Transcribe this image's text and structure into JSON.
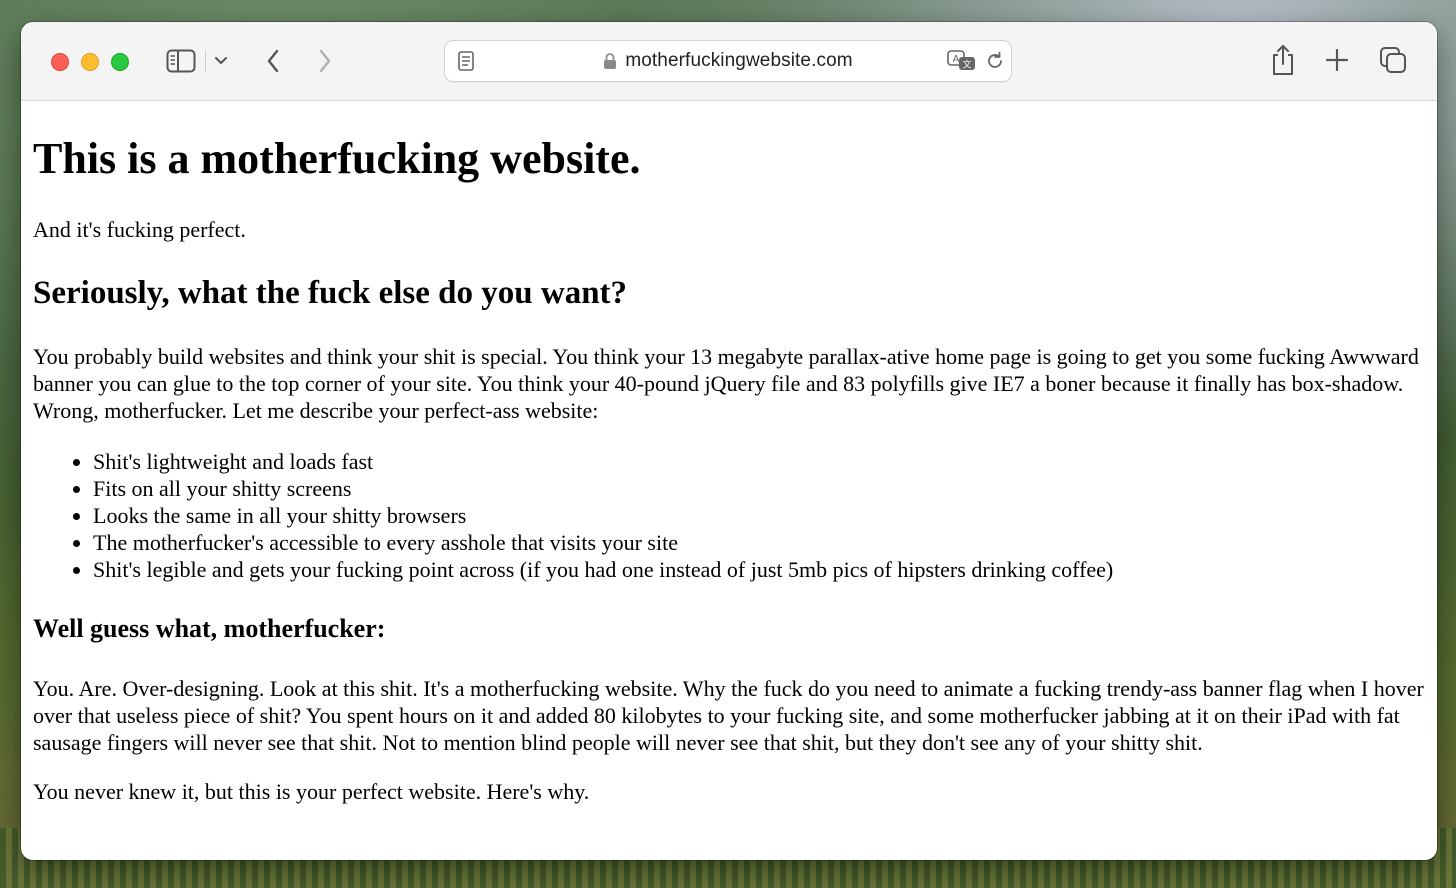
{
  "browser": {
    "url": "motherfuckingwebsite.com",
    "icons": {
      "sidebar": "sidebar-icon",
      "sidebar_menu": "chevron-down-icon",
      "back": "chevron-left-icon",
      "forward": "chevron-right-icon",
      "reader": "reader-icon",
      "lock": "lock-icon",
      "translate": "translate-icon",
      "reload": "reload-icon",
      "share": "share-icon",
      "new_tab": "plus-icon",
      "tab_overview": "tabs-icon"
    },
    "traffic_lights": {
      "close": "#fe5f57",
      "minimize": "#febc2e",
      "zoom": "#28c840"
    }
  },
  "page": {
    "title": "This is a motherfucking website.",
    "intro": "And it's fucking perfect.",
    "subtitle": "Seriously, what the fuck else do you want?",
    "paragraph1": "You probably build websites and think your shit is special. You think your 13 megabyte parallax-ative home page is going to get you some fucking Awwward banner you can glue to the top corner of your site. You think your 40-pound jQuery file and 83 polyfills give IE7 a boner because it finally has box-shadow. Wrong, motherfucker. Let me describe your perfect-ass website:",
    "list": [
      "Shit's lightweight and loads fast",
      "Fits on all your shitty screens",
      "Looks the same in all your shitty browsers",
      "The motherfucker's accessible to every asshole that visits your site",
      "Shit's legible and gets your fucking point across (if you had one instead of just 5mb pics of hipsters drinking coffee)"
    ],
    "heading3": "Well guess what, motherfucker:",
    "paragraph2": "You. Are. Over-designing. Look at this shit. It's a motherfucking website. Why the fuck do you need to animate a fucking trendy-ass banner flag when I hover over that useless piece of shit? You spent hours on it and added 80 kilobytes to your fucking site, and some motherfucker jabbing at it on their iPad with fat sausage fingers will never see that shit. Not to mention blind people will never see that shit, but they don't see any of your shitty shit.",
    "paragraph3": "You never knew it, but this is your perfect website. Here's why."
  }
}
